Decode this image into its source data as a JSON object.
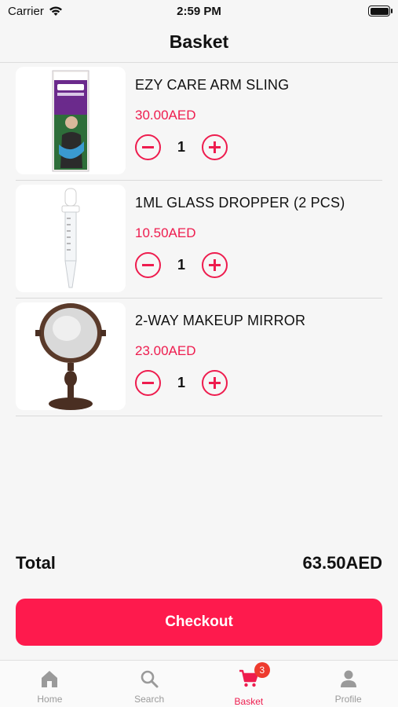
{
  "status_bar": {
    "carrier": "Carrier",
    "time": "2:59 PM"
  },
  "header": {
    "title": "Basket"
  },
  "items": [
    {
      "name": "EZY CARE ARM SLING",
      "price": "30.00AED",
      "quantity": "1",
      "image_icon": "arm-sling-image"
    },
    {
      "name": "1ML GLASS DROPPER (2 PCS)",
      "price": "10.50AED",
      "quantity": "1",
      "image_icon": "glass-dropper-image"
    },
    {
      "name": "2-WAY MAKEUP MIRROR",
      "price": "23.00AED",
      "quantity": "1",
      "image_icon": "makeup-mirror-image"
    }
  ],
  "summary": {
    "total_label": "Total",
    "total_value": "63.50AED"
  },
  "checkout_label": "Checkout",
  "tabs": [
    {
      "label": "Home",
      "icon": "home-icon"
    },
    {
      "label": "Search",
      "icon": "search-icon"
    },
    {
      "label": "Basket",
      "icon": "cart-icon",
      "badge": "3",
      "active": true
    },
    {
      "label": "Profile",
      "icon": "profile-icon"
    }
  ],
  "colors": {
    "accent": "#ee1c4e",
    "checkout": "#fe1a4d",
    "badge": "#ee3b2e"
  }
}
